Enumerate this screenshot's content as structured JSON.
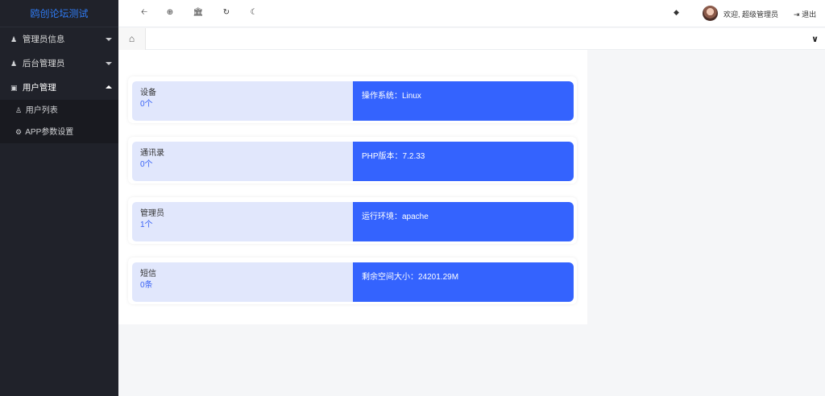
{
  "app": {
    "title": "鸥创论坛测试"
  },
  "sidebar": {
    "items": [
      {
        "label": "管理员信息",
        "icon": "user-icon"
      },
      {
        "label": "后台管理员",
        "icon": "user-icon"
      },
      {
        "label": "用户管理",
        "icon": "id-card-icon"
      }
    ],
    "submenu": [
      {
        "label": "用户列表",
        "icon": "user-outline-icon"
      },
      {
        "label": "APP参数设置",
        "icon": "gear-icon"
      }
    ]
  },
  "header": {
    "welcome": "欢迎, 超级管理员",
    "logout": "退出",
    "icons": [
      "arrow-left-icon",
      "crosshair-icon",
      "bank-icon",
      "refresh-icon",
      "moon-icon",
      "tag-icon"
    ]
  },
  "cards": [
    {
      "title": "设备",
      "count": "0个",
      "info": "操作系统：Linux"
    },
    {
      "title": "通讯录",
      "count": "0个",
      "info": "PHP版本：7.2.33"
    },
    {
      "title": "管理员",
      "count": "1个",
      "info": "运行环境：apache"
    },
    {
      "title": "短信",
      "count": "0条",
      "info": "剩余空间大小：24201.29M"
    }
  ],
  "colors": {
    "sidebar": "#20222a",
    "accent": "#3463fe",
    "card_light": "#e1e7fc",
    "brand": "#2f7cf6"
  }
}
